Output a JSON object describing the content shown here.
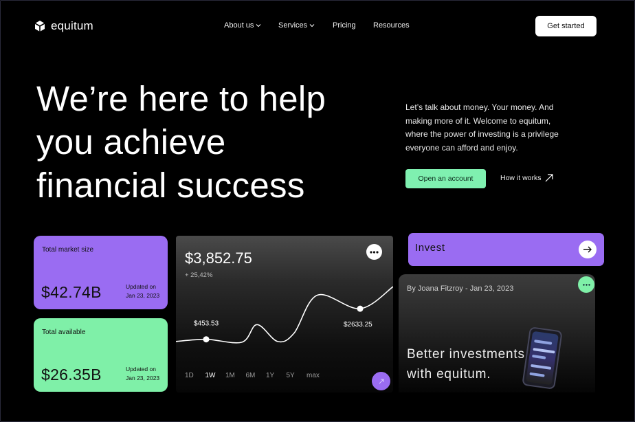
{
  "brand": {
    "name": "equitum"
  },
  "nav": {
    "items": [
      {
        "label": "About us",
        "has_dropdown": true
      },
      {
        "label": "Services",
        "has_dropdown": true
      },
      {
        "label": "Pricing",
        "has_dropdown": false
      },
      {
        "label": "Resources",
        "has_dropdown": false
      }
    ],
    "cta_label": "Get started"
  },
  "hero": {
    "title_lines": [
      "We’re here to help",
      "you achieve",
      "financial success"
    ],
    "description_lines": [
      "Let’s talk  about money. Your money. And",
      "making more of it. Welcome to equitum,",
      "where the power of investing is a privilege",
      "everyone can afford and enjoy."
    ],
    "primary_button": "Open an account",
    "secondary_link": "How it works"
  },
  "stats": [
    {
      "label": "Total market size",
      "value": "$42.74B",
      "updated_label": "Updated on",
      "updated_date": "Jan 23, 2023",
      "color": "#9a6cf2"
    },
    {
      "label": "Total available",
      "value": "$26.35B",
      "updated_label": "Updated on",
      "updated_date": "Jan 23, 2023",
      "color": "#7ff0a8"
    }
  ],
  "chart_card": {
    "price": "$3,852.75",
    "change": "+ 25,42%",
    "ranges": [
      "1D",
      "1W",
      "1M",
      "6M",
      "1Y",
      "5Y",
      "max"
    ],
    "active_range": "1W",
    "markers": [
      {
        "label": "$453.53"
      },
      {
        "label": "$2633.25"
      }
    ]
  },
  "chart_data": {
    "type": "line",
    "title": "",
    "xlabel": "",
    "ylabel": "",
    "series": [
      {
        "values": [
          300,
          453.53,
          250,
          1500,
          300,
          900,
          3600,
          2633.25,
          4200
        ]
      }
    ],
    "annotations": [
      "$453.53",
      "$2633.25"
    ],
    "grid": false
  },
  "invest": {
    "label": "Invest"
  },
  "article": {
    "byline": "By Joana Fitzroy - Jan 23, 2023",
    "title_lines": [
      "Better investments",
      "with equitum."
    ]
  },
  "colors": {
    "purple": "#9a6cf2",
    "green": "#7ff0a8",
    "background": "#000000"
  }
}
